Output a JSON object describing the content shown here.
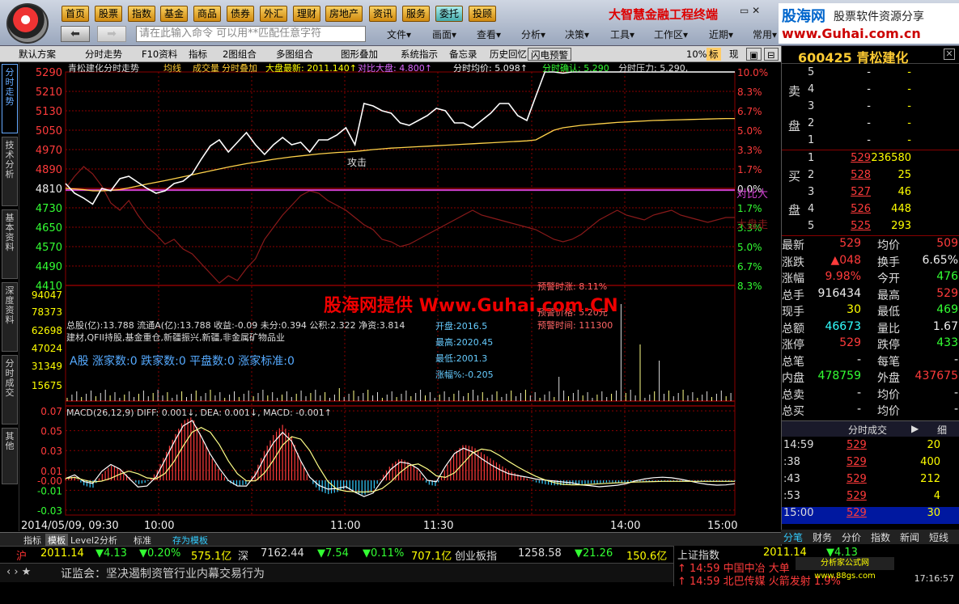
{
  "nav": [
    "首页",
    "股票",
    "指数",
    "基金",
    "商品",
    "债券",
    "外汇",
    "理财",
    "房地产",
    "资讯",
    "服务",
    "委托",
    "投顾"
  ],
  "command_placeholder": "请在此输入命令  可以用**匹配任意字符",
  "menu": [
    "文件▾",
    "画面▾",
    "查看▾",
    "分析▾",
    "决策▾",
    "工具▾",
    "工作区▾",
    "近期▾",
    "常用▾"
  ],
  "brand": "大智慧金融工程终端",
  "watermark_top": {
    "a": "股海网",
    "b": "股票软件资源分享",
    "c": "www.Guhai.com.cn"
  },
  "toolbar": [
    "默认方案",
    "分时走势",
    "F10资料",
    "指标",
    "2图组合",
    "多图组合",
    "图形叠加",
    "系统指示",
    "备忘录",
    "历史回忆",
    "闪电预警"
  ],
  "toolbar_right": [
    "10%",
    "标",
    "现"
  ],
  "side_tabs": [
    "分时走势",
    "技术分析",
    "基本资料",
    "深度资料",
    "分时成交",
    "其他"
  ],
  "chart_header": {
    "name": "青松建化分时走势",
    "items": [
      "均线",
      "成交量",
      "分时叠加"
    ],
    "dapan": "大盘最新: 2011.140↑",
    "duibi": "对比大盘: 4.800↑",
    "junjia": "分时均价: 5.098↑",
    "queren": "分时确认: 5.290",
    "yali": "分时压力: 5.290,"
  },
  "y_prices": [
    "5290",
    "5210",
    "5130",
    "5050",
    "4970",
    "4890",
    "4810",
    "4730",
    "4650",
    "4570",
    "4490",
    "4410"
  ],
  "y_pct": [
    "10.0%",
    "8.3%",
    "6.7%",
    "5.0%",
    "3.3%",
    "1.7%",
    "0.0%",
    "1.7%",
    "3.3%",
    "5.0%",
    "6.7%",
    "8.3%"
  ],
  "y_vol": [
    "94047",
    "78373",
    "62698",
    "47024",
    "31349",
    "15675"
  ],
  "y_macd": [
    "0.07",
    "0.05",
    "0.03",
    "0.01",
    "-0.00",
    "-0.01",
    "-0.03"
  ],
  "x_labels": [
    "2014/05/09, 09:30",
    "10:00",
    "11:00",
    "11:30",
    "14:00",
    "15:00"
  ],
  "tags": {
    "gongji": "攻击",
    "duibi": "对比大",
    "dapan": "大盘走"
  },
  "info_lines": [
    "总股(亿):13.788  流通A(亿):13.788  收益:-0.09  未分:0.394  公积:2.322  净资:3.814",
    "建材,QFII持股,基金重仓,新疆振兴,新疆,非金属矿物品业"
  ],
  "breadth": "A股 涨家数:0 跌家数:0 平盘数:0 涨家标准:0",
  "dapan_box": [
    "开盘:2016.5",
    "最高:2020.45",
    "最低:2001.3",
    "涨幅%:-0.205"
  ],
  "alert_box": [
    "预警时涨: 8.11%",
    "预警价格: 5.20元",
    "预警时间: 111300"
  ],
  "macd_title": "MACD(26,12,9)  DIFF: 0.001↓, DEA: 0.001↓, MACD: -0.001↑",
  "red_watermark": "股海网提供 Www.Guhai.com.CN",
  "stock": {
    "code": "600425",
    "name": "青松建化"
  },
  "sell_orders": [
    {
      "lvl": "5",
      "px": "-",
      "vol": "-"
    },
    {
      "lvl": "4",
      "px": "-",
      "vol": "-"
    },
    {
      "lvl": "3",
      "px": "-",
      "vol": "-"
    },
    {
      "lvl": "2",
      "px": "-",
      "vol": "-"
    },
    {
      "lvl": "1",
      "px": "-",
      "vol": "-"
    }
  ],
  "buy_orders": [
    {
      "lvl": "1",
      "px": "529",
      "vol": "236580"
    },
    {
      "lvl": "2",
      "px": "528",
      "vol": "25"
    },
    {
      "lvl": "3",
      "px": "527",
      "vol": "46"
    },
    {
      "lvl": "4",
      "px": "526",
      "vol": "448"
    },
    {
      "lvl": "5",
      "px": "525",
      "vol": "293"
    }
  ],
  "labels": {
    "sell1": "卖",
    "sell2": "盘",
    "buy1": "买",
    "buy2": "盘"
  },
  "quote": [
    {
      "l1": "最新",
      "v1": "529",
      "c1": "red",
      "l2": "均价",
      "v2": "509",
      "c2": "red"
    },
    {
      "l1": "涨跌",
      "v1": "▲048",
      "c1": "red",
      "l2": "换手",
      "v2": "6.65%",
      "c2": "wht"
    },
    {
      "l1": "涨幅",
      "v1": "9.98%",
      "c1": "red",
      "l2": "今开",
      "v2": "476",
      "c2": "grn"
    },
    {
      "l1": "总手",
      "v1": "916434",
      "c1": "wht",
      "l2": "最高",
      "v2": "529",
      "c2": "red"
    },
    {
      "l1": "现手",
      "v1": "30",
      "c1": "yel",
      "l2": "最低",
      "v2": "469",
      "c2": "grn"
    },
    {
      "l1": "总额",
      "v1": "46673",
      "c1": "cyn",
      "l2": "量比",
      "v2": "1.67",
      "c2": "wht"
    },
    {
      "l1": "涨停",
      "v1": "529",
      "c1": "red",
      "l2": "跌停",
      "v2": "433",
      "c2": "grn"
    },
    {
      "l1": "总笔",
      "v1": "-",
      "c1": "wht",
      "l2": "每笔",
      "v2": "-",
      "c2": "wht"
    },
    {
      "l1": "内盘",
      "v1": "478759",
      "c1": "grn",
      "l2": "外盘",
      "v2": "437675",
      "c2": "red"
    },
    {
      "l1": "总卖",
      "v1": "-",
      "c1": "wht",
      "l2": "均价",
      "v2": "-",
      "c2": "wht"
    },
    {
      "l1": "总买",
      "v1": "-",
      "c1": "wht",
      "l2": "均价",
      "v2": "-",
      "c2": "wht"
    }
  ],
  "ticks_header": "分时成交",
  "ticks_btn": "细",
  "ticks": [
    {
      "t": "14:59",
      "p": "529",
      "q": "20"
    },
    {
      "t": ":38",
      "p": "529",
      "q": "400"
    },
    {
      "t": ":43",
      "p": "529",
      "q": "212"
    },
    {
      "t": ":53",
      "p": "529",
      "q": "4"
    },
    {
      "t": "15:00",
      "p": "529",
      "q": "30"
    }
  ],
  "right_tabs": [
    "分笔",
    "财务",
    "分价",
    "指数",
    "新闻",
    "短线"
  ],
  "bottom_tabs": [
    "指标",
    "模板",
    "Level2分析",
    "标准",
    "存为模板"
  ],
  "ticker": [
    {
      "t": "沪",
      "c": "#f33"
    },
    {
      "t": "2011.14",
      "c": "#ff0"
    },
    {
      "t": "▼4.13",
      "c": "#3f3"
    },
    {
      "t": "▼0.20%",
      "c": "#3f3"
    },
    {
      "t": "575.1亿",
      "c": "#ff0"
    },
    {
      "t": "深",
      "c": "#ddd"
    },
    {
      "t": "7162.44",
      "c": "#ddd"
    },
    {
      "t": "▼7.54",
      "c": "#3f3"
    },
    {
      "t": "▼0.11%",
      "c": "#3f3"
    },
    {
      "t": "707.1亿",
      "c": "#ff0"
    },
    {
      "t": "创业板指",
      "c": "#ddd"
    },
    {
      "t": "1258.58",
      "c": "#ddd"
    },
    {
      "t": "▼21.26",
      "c": "#3f3"
    },
    {
      "t": "150.6亿",
      "c": "#ff0"
    }
  ],
  "news": "证监会：坚决遏制资管行业内幕交易行为",
  "rticker": {
    "name": "上证指数",
    "val": "2011.14",
    "chg": "▼4.13"
  },
  "alerts": [
    "↑ 14:59 中国中冶 大单",
    "↑ 14:59 北巴传媒 火箭发射 1.9%"
  ],
  "wm2": "分析家公式网 www.88gs.com",
  "clock": "17:16:57",
  "colors": {
    "price": "#ffffff",
    "avg": "#ffd24a",
    "compare": "#d040d0",
    "dapan": "#8a1a1a",
    "grid": "#8b0000",
    "up": "#ff3b3b",
    "down": "#3f3"
  },
  "chart_data": {
    "type": "line",
    "series": [
      {
        "values": [
          4830,
          4790,
          4770,
          4745,
          4810,
          4800,
          4850,
          4860,
          4835,
          4810,
          4790,
          4800,
          4830,
          4840,
          4870,
          4930,
          4985,
          5010,
          4960,
          5000,
          5040,
          4990,
          4950,
          4990,
          5020,
          4990,
          5000,
          4960,
          5010,
          5010,
          5030,
          5060,
          4990,
          5160,
          5150,
          5130,
          5120,
          5080,
          5070,
          5090,
          5110,
          5140,
          5130,
          5080,
          5080,
          5060,
          5090,
          5120,
          5160,
          5160,
          5110,
          5090,
          5190,
          5310,
          5290,
          5285,
          5290,
          5290,
          5290,
          5290,
          5290,
          5290,
          5290,
          5290,
          5290,
          5290,
          5290,
          5290,
          5290,
          5290,
          5290,
          5290,
          5290,
          5290,
          5290
        ]
      },
      {
        "values": [
          4810,
          4808,
          4805,
          4800,
          4800,
          4802,
          4805,
          4812,
          4820,
          4828,
          4835,
          4842,
          4850,
          4858,
          4866,
          4874,
          4882,
          4890,
          4898,
          4905,
          4912,
          4918,
          4924,
          4930,
          4935,
          4940,
          4944,
          4948,
          4952,
          4955,
          4958,
          4960,
          4962,
          4966,
          4970,
          4973,
          4976,
          4978,
          4980,
          4982,
          4984,
          4986,
          4988,
          4990,
          4992,
          4994,
          4996,
          4998,
          5000,
          5002,
          5004,
          5006,
          5010,
          5030,
          5050,
          5060,
          5065,
          5070,
          5073,
          5076,
          5079,
          5082,
          5084,
          5086,
          5088,
          5090,
          5091,
          5092,
          5093,
          5094,
          5095,
          5096,
          5097,
          5098,
          5098
        ]
      }
    ],
    "ylim": [
      4410,
      5290
    ],
    "macd": [
      0.002,
      0.004,
      -0.005,
      -0.008,
      0.006,
      0.015,
      0.012,
      0.004,
      -0.004,
      -0.002,
      0.008,
      0.026,
      0.044,
      0.06,
      0.064,
      0.045,
      0.025,
      0.01,
      -0.002,
      -0.006,
      -0.004,
      0.01,
      0.03,
      0.046,
      0.056,
      0.044,
      0.02,
      0.0,
      -0.01,
      -0.014,
      -0.012,
      -0.008,
      -0.012,
      -0.015,
      -0.01,
      0.004,
      0.016,
      0.022,
      0.018,
      0.01,
      -0.004,
      -0.006,
      0.012,
      0.028,
      0.036,
      0.034,
      0.028,
      0.022,
      0.016,
      0.01,
      0.006,
      0.002,
      -0.002,
      -0.004,
      -0.005,
      -0.005,
      -0.004,
      -0.004,
      -0.003,
      -0.003,
      -0.002,
      -0.002,
      -0.002,
      -0.001,
      -0.001,
      -0.001,
      -0.001,
      -0.001,
      -0.001,
      -0.001,
      -0.001,
      -0.001,
      -0.001,
      -0.001,
      -0.001
    ]
  }
}
